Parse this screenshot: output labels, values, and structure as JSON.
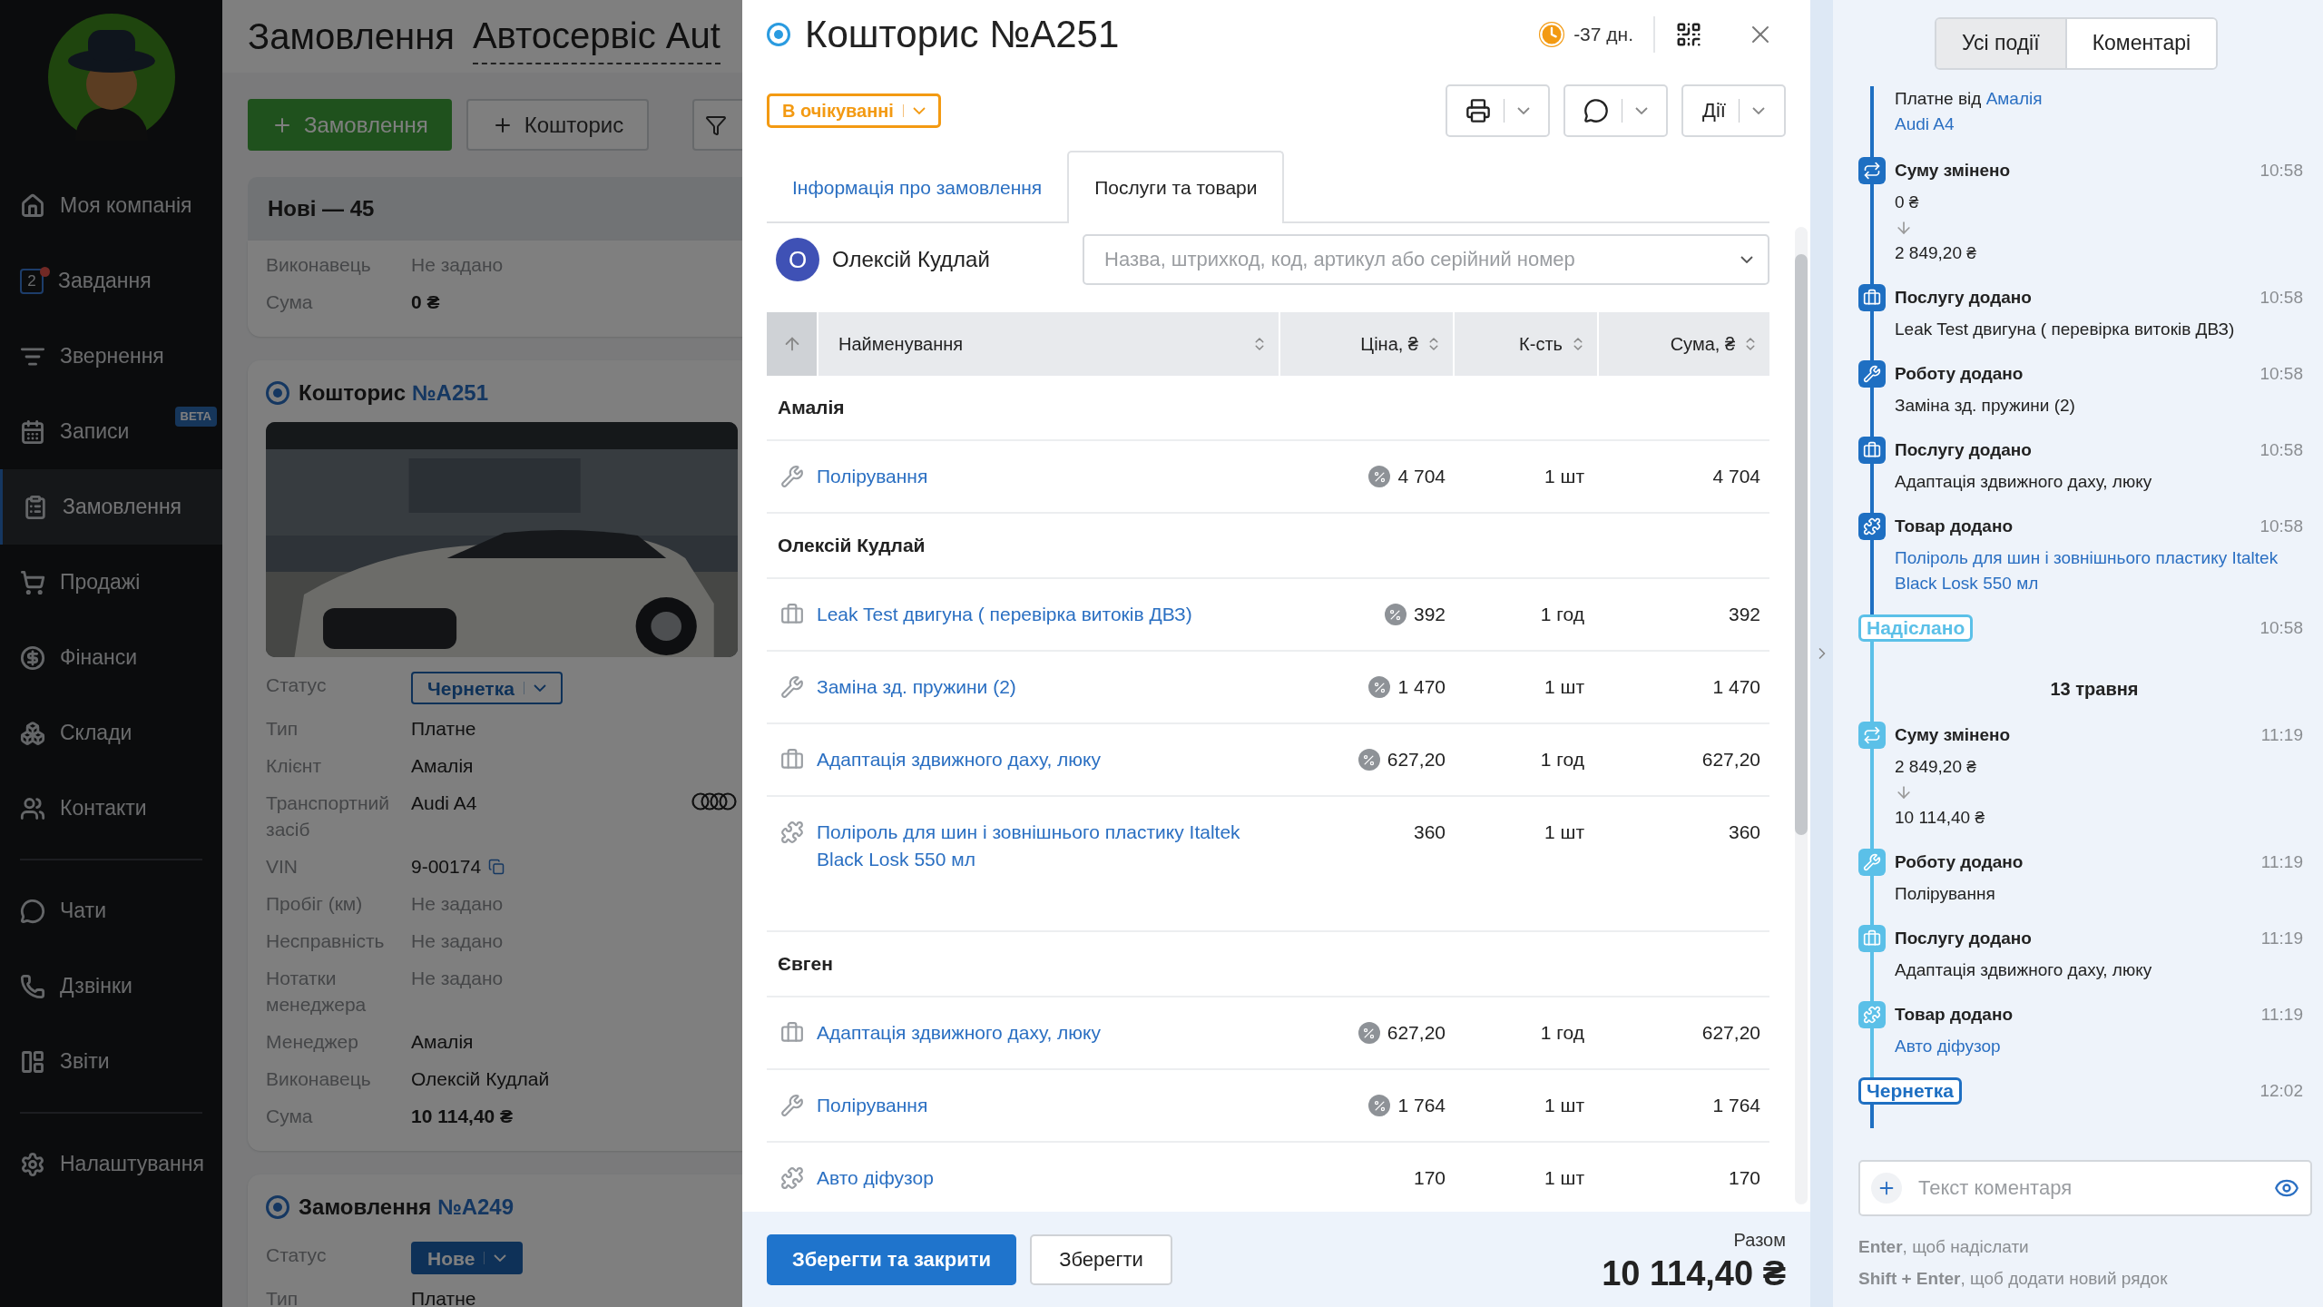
{
  "sidebar": {
    "groups": [
      [
        {
          "label": "Моя компанія",
          "selected": false,
          "notification": false
        },
        {
          "label": "Завдання",
          "selected": false,
          "notification": true,
          "count": "2"
        },
        {
          "label": "Звернення",
          "selected": false,
          "notification": false
        },
        {
          "label": "Записи",
          "selected": false,
          "notification": false,
          "tag": "BETA"
        },
        {
          "label": "Замовлення",
          "selected": true,
          "notification": false
        },
        {
          "label": "Продажі",
          "selected": false,
          "notification": false
        },
        {
          "label": "Фінанси",
          "selected": false,
          "notification": false
        },
        {
          "label": "Склади",
          "selected": false,
          "notification": false
        },
        {
          "label": "Контакти",
          "selected": false,
          "notification": false
        }
      ],
      [
        {
          "label": "Чати",
          "selected": false,
          "notification": false
        },
        {
          "label": "Дзвінки",
          "selected": false,
          "notification": false
        },
        {
          "label": "Звіти",
          "selected": false,
          "notification": false
        }
      ],
      [
        {
          "label": "Налаштування",
          "selected": false,
          "notification": false
        }
      ]
    ]
  },
  "page": {
    "title": "Замовлення",
    "workspace": "Автосервіс Aut",
    "buttons": [
      {
        "label": "Замовлення",
        "kind": "primary"
      },
      {
        "label": "Кошторис",
        "kind": "outline"
      }
    ],
    "column": {
      "title": "Нові — 45",
      "cards": [
        {
          "partial": true,
          "picture": false,
          "fields": [
            {
              "label": "Виконавець",
              "value": "Не задано",
              "kind": "empty"
            },
            {
              "label": "Сума",
              "value": "0 ₴",
              "kind": "total"
            }
          ]
        },
        {
          "partial": false,
          "doc": "Кошторис",
          "number": "№A251",
          "picture": true,
          "fields": [
            {
              "label": "Статус",
              "value": "Чернетка",
              "kind": "status",
              "filled": false
            },
            {
              "label": "Тип",
              "value": "Платне",
              "kind": "text"
            },
            {
              "label": "Клієнт",
              "value": "Амалія",
              "kind": "text"
            },
            {
              "label": "Транспортний засіб",
              "value": "Audi A4",
              "kind": "vehicle"
            },
            {
              "label": "VIN",
              "value": "9-00174",
              "kind": "vin"
            },
            {
              "label": "Пробіг (км)",
              "value": "Не задано",
              "kind": "empty"
            },
            {
              "label": "Несправність",
              "value": "Не задано",
              "kind": "empty"
            },
            {
              "label": "Нотатки менеджера",
              "value": "Не задано",
              "kind": "empty"
            },
            {
              "label": "Менеджер",
              "value": "Амалія",
              "kind": "text"
            },
            {
              "label": "Виконавець",
              "value": "Олексій Кудлай",
              "kind": "text"
            },
            {
              "label": "Сума",
              "value": "10 114,40 ₴",
              "kind": "total"
            }
          ]
        },
        {
          "partial": false,
          "doc": "Замовлення",
          "number": "№A249",
          "picture": false,
          "fields": [
            {
              "label": "Статус",
              "value": "Нове",
              "kind": "status",
              "filled": true
            },
            {
              "label": "Тип",
              "value": "Платне",
              "kind": "text"
            }
          ]
        }
      ]
    }
  },
  "modal": {
    "title": "Кошторис №A251",
    "overdue": "-37 дн.",
    "status": "В очікуванні",
    "actions": [
      {
        "kind": "print"
      },
      {
        "kind": "chat"
      },
      {
        "kind": "menu",
        "label": "Дії"
      }
    ],
    "tabs": [
      {
        "label": "Інформація про замовлення",
        "selected": false
      },
      {
        "label": "Послуги та товари",
        "selected": true
      }
    ],
    "assignee": {
      "initial": "О",
      "name": "Олексій Кудлай"
    },
    "search": {
      "placeholder": "Назва, штрихкод, код, артикул або серійний номер"
    },
    "table": {
      "columns": [
        "Найменування",
        "Ціна, ₴",
        "К-сть",
        "Сума, ₴"
      ],
      "groups": [
        {
          "name": "Амалія",
          "rows": [
            {
              "kind": "work",
              "name": "Полірування",
              "discount": true,
              "price": "4 704",
              "qty": "1 шт",
              "sum": "4 704"
            }
          ]
        },
        {
          "name": "Олексій Кудлай",
          "rows": [
            {
              "kind": "service",
              "name": "Leak Test двигуна ( перевірка витоків ДВЗ)",
              "discount": true,
              "price": "392",
              "qty": "1 год",
              "sum": "392"
            },
            {
              "kind": "work",
              "name": "Заміна зд. пружини (2)",
              "discount": true,
              "price": "1 470",
              "qty": "1 шт",
              "sum": "1 470"
            },
            {
              "kind": "service",
              "name": "Адаптація здвижного даху, люку",
              "discount": true,
              "price": "627,20",
              "qty": "1 год",
              "sum": "627,20"
            },
            {
              "kind": "product",
              "name": "Поліроль для шин і зовнішнього пластику Italtek Black Losk 550 мл",
              "discount": false,
              "price": "360",
              "qty": "1 шт",
              "sum": "360"
            }
          ]
        },
        {
          "name": "Євген",
          "rows": [
            {
              "kind": "service",
              "name": "Адаптація здвижного даху, люку",
              "discount": true,
              "price": "627,20",
              "qty": "1 год",
              "sum": "627,20"
            },
            {
              "kind": "work",
              "name": "Полірування",
              "discount": true,
              "price": "1 764",
              "qty": "1 шт",
              "sum": "1 764"
            },
            {
              "kind": "product",
              "name": "Авто діфузор",
              "discount": false,
              "price": "170",
              "qty": "1 шт",
              "sum": "170"
            }
          ]
        }
      ]
    },
    "footer": {
      "save_close": "Зберегти та закрити",
      "save": "Зберегти",
      "total_label": "Разом",
      "total": "10 114,40 ₴"
    }
  },
  "events_panel": {
    "tabs": [
      {
        "label": "Усі події",
        "selected": true
      },
      {
        "label": "Коментарі",
        "selected": false
      }
    ],
    "timeline": [
      {
        "kind": "intro",
        "color": "#1e6fc2",
        "prefix": "Платне від",
        "client": "Амалія",
        "vehicle": "Audi A4"
      },
      {
        "kind": "amount",
        "color": "#1e6fc2",
        "title": "Суму змінено",
        "time": "10:58",
        "from": "0 ₴",
        "to": "2 849,20 ₴"
      },
      {
        "kind": "service",
        "color": "#1e6fc2",
        "title": "Послугу додано",
        "time": "10:58",
        "detail": "Leak Test двигуна ( перевірка витоків ДВЗ)",
        "link": false
      },
      {
        "kind": "work",
        "color": "#1e6fc2",
        "title": "Роботу додано",
        "time": "10:58",
        "detail": "Заміна зд. пружини (2)",
        "link": false
      },
      {
        "kind": "service",
        "color": "#1e6fc2",
        "title": "Послугу додано",
        "time": "10:58",
        "detail": "Адаптація здвижного даху, люку",
        "link": false
      },
      {
        "kind": "product",
        "color": "#1e6fc2",
        "title": "Товар додано",
        "time": "10:58",
        "detail": "Поліроль для шин і зовнішнього пластику Italtek Black Losk 550 мл",
        "link": true
      },
      {
        "kind": "status",
        "color": "#5bc0e8",
        "label": "Надіслано",
        "time": "10:58"
      },
      {
        "kind": "date",
        "label": "13 травня"
      },
      {
        "kind": "amount",
        "color": "#5bc0e8",
        "title": "Суму змінено",
        "time": "11:19",
        "from": "2 849,20 ₴",
        "to": "10 114,40 ₴"
      },
      {
        "kind": "work",
        "color": "#5bc0e8",
        "title": "Роботу додано",
        "time": "11:19",
        "detail": "Полірування",
        "link": false
      },
      {
        "kind": "service",
        "color": "#5bc0e8",
        "title": "Послугу додано",
        "time": "11:19",
        "detail": "Адаптація здвижного даху, люку",
        "link": false
      },
      {
        "kind": "product",
        "color": "#5bc0e8",
        "title": "Товар додано",
        "time": "11:19",
        "detail": "Авто діфузор",
        "link": true
      },
      {
        "kind": "status",
        "color": "#1e6fc2",
        "label": "Чернетка",
        "time": "12:02"
      }
    ],
    "comment": {
      "placeholder": "Текст коментаря"
    },
    "hints": [
      "**Enter**, щоб надіслати",
      "**Shift + Enter**, щоб додати новий рядок"
    ]
  }
}
